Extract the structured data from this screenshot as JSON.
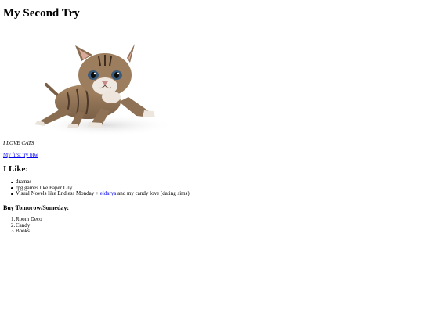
{
  "page": {
    "title": "My Second Try",
    "image_alt": "kitten",
    "caption": "I LOVE CATS",
    "link_text": "My first try btw"
  },
  "likes": {
    "heading": "I Like:",
    "items": [
      {
        "text": "dramas"
      },
      {
        "text": "rpg games like Paper Lily"
      },
      {
        "before": "Visual Novels like Endless Monday + ",
        "link": "eldarya",
        "after": " and my candy love (dating sims)"
      }
    ]
  },
  "buy": {
    "heading": "Buy Tomorow/Someday:",
    "items": [
      {
        "num": "1.",
        "text": "Room Deco"
      },
      {
        "num": "2.",
        "text": "Candy"
      },
      {
        "num": "3.",
        "text": "Books"
      }
    ]
  },
  "colors": {
    "link": "#0000ee",
    "background": "#ffffff",
    "text": "#000000"
  }
}
